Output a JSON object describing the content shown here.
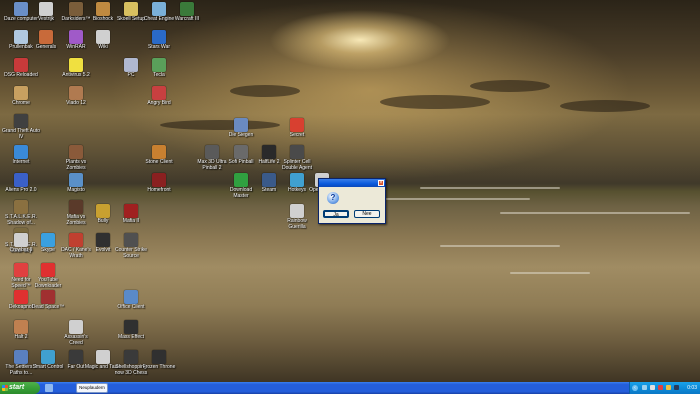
{
  "desktop": {
    "icons": [
      {
        "label": "Daze computer",
        "color": "#6a8fc8"
      },
      {
        "label": "Vestrijk",
        "color": "#d0d0d0"
      },
      {
        "label": "Darksiders™",
        "color": "#7a5d3a"
      },
      {
        "label": "Bioshock",
        "color": "#c08a40"
      },
      {
        "label": "Skoell Setup",
        "color": "#d8c060"
      },
      {
        "label": "Cheat Engine",
        "color": "#7ab0d8"
      },
      {
        "label": "Warcraft III",
        "color": "#3a7a3a"
      },
      {
        "label": "Prullenbak",
        "color": "#b0c8e0"
      },
      {
        "label": "Generals",
        "color": "#c86a3a"
      },
      {
        "label": "WinRAR",
        "color": "#a05ac8"
      },
      {
        "label": "Wiki",
        "color": "#d0d0d0"
      },
      {
        "label": "Stars War",
        "color": "#2a6ac8"
      },
      {
        "label": "DSG Reloaded",
        "color": "#c83a3a"
      },
      {
        "label": "Antivirus 5.2",
        "color": "#f0e040"
      },
      {
        "label": "PC",
        "color": "#b0b8d0"
      },
      {
        "label": "Tecla",
        "color": "#5aa05a"
      },
      {
        "label": "Chrome",
        "color": "#c8a060"
      },
      {
        "label": "Viado 12",
        "color": "#b07a50"
      },
      {
        "label": "Angry Bird",
        "color": "#c84040"
      },
      {
        "label": "Grand Theft Auto IV",
        "color": "#404040"
      },
      {
        "label": "Internet",
        "color": "#3a8ad8"
      },
      {
        "label": "Die Siegen",
        "color": "#6a8ac0"
      },
      {
        "label": "Plants vs Zombies",
        "color": "#8a5a3a"
      },
      {
        "label": "Secret",
        "color": "#d84030"
      },
      {
        "label": "Aliens Pro 2.0",
        "color": "#3a60c8"
      },
      {
        "label": "Magisto",
        "color": "#5a90c8"
      },
      {
        "label": "Stone Client",
        "color": "#c88030"
      },
      {
        "label": "Max 3D Ultra Pinball 2",
        "color": "#5a5a5a"
      },
      {
        "label": "Sofi Pinball",
        "color": "#6a6a6a"
      },
      {
        "label": "HalfLife 2",
        "color": "#2a2a2a"
      },
      {
        "label": "Splinter Cell Double Agent",
        "color": "#4a4a4a"
      },
      {
        "label": "S.T.A.L.K.E.R. Shadow of...",
        "color": "#8a7040"
      },
      {
        "label": "Mafia vs Zombies",
        "color": "#5a3a2a"
      },
      {
        "label": "Homefront",
        "color": "#8a2020"
      },
      {
        "label": "Download Master",
        "color": "#30a040"
      },
      {
        "label": "Steam",
        "color": "#3a5a8a"
      },
      {
        "label": "Hotkeys",
        "color": "#40a0d0"
      },
      {
        "label": "Open Legal",
        "color": "#d0d0d0"
      },
      {
        "label": "S.T.A.L.K.E.R. Clear Sky",
        "color": "#7a6a40"
      },
      {
        "label": "Bully",
        "color": "#c8a030"
      },
      {
        "label": "Mafia II",
        "color": "#a02020"
      },
      {
        "label": "Rainbow Guerilla",
        "color": "#d0d0d0"
      },
      {
        "label": "Crowbar II",
        "color": "#d0d0d0"
      },
      {
        "label": "Skype",
        "color": "#3aa0e0"
      },
      {
        "label": "DAC / Kane's Wrath",
        "color": "#c04030"
      },
      {
        "label": "Evolvit",
        "color": "#303030"
      },
      {
        "label": "Counter Strike Source",
        "color": "#505050"
      },
      {
        "label": "Need for Speed™",
        "color": "#e04040"
      },
      {
        "label": "YouTube Downloader",
        "color": "#e03030"
      },
      {
        "label": "Dekoapnot",
        "color": "#e03030"
      },
      {
        "label": "Dead Space™",
        "color": "#a03030"
      },
      {
        "label": "Office Client",
        "color": "#5a8ac8"
      },
      {
        "label": "Halt 2",
        "color": "#c08050"
      },
      {
        "label": "Assassin's Creed",
        "color": "#d0d0d0"
      },
      {
        "label": "Mass Effect",
        "color": "#303030"
      },
      {
        "label": "The Settlers 7 Paths to...",
        "color": "#5a80c0"
      },
      {
        "label": "Smart Control",
        "color": "#40a0d0"
      },
      {
        "label": "Far Out",
        "color": "#3a3a3a"
      },
      {
        "label": "Magic and Taste",
        "color": "#d0d0d0"
      },
      {
        "label": "Shellshopping now 3D Chess",
        "color": "#3a3a3a"
      },
      {
        "label": "Frozen Throne",
        "color": "#303030"
      }
    ]
  },
  "dialog": {
    "icon": "question-icon",
    "yes_label": "Ja",
    "no_label": "Nee",
    "close_glyph": "×"
  },
  "taskbar": {
    "start_label": "start",
    "task_label": "Neuplaudern",
    "clock": "0:03",
    "tray_arrow": "‹"
  }
}
